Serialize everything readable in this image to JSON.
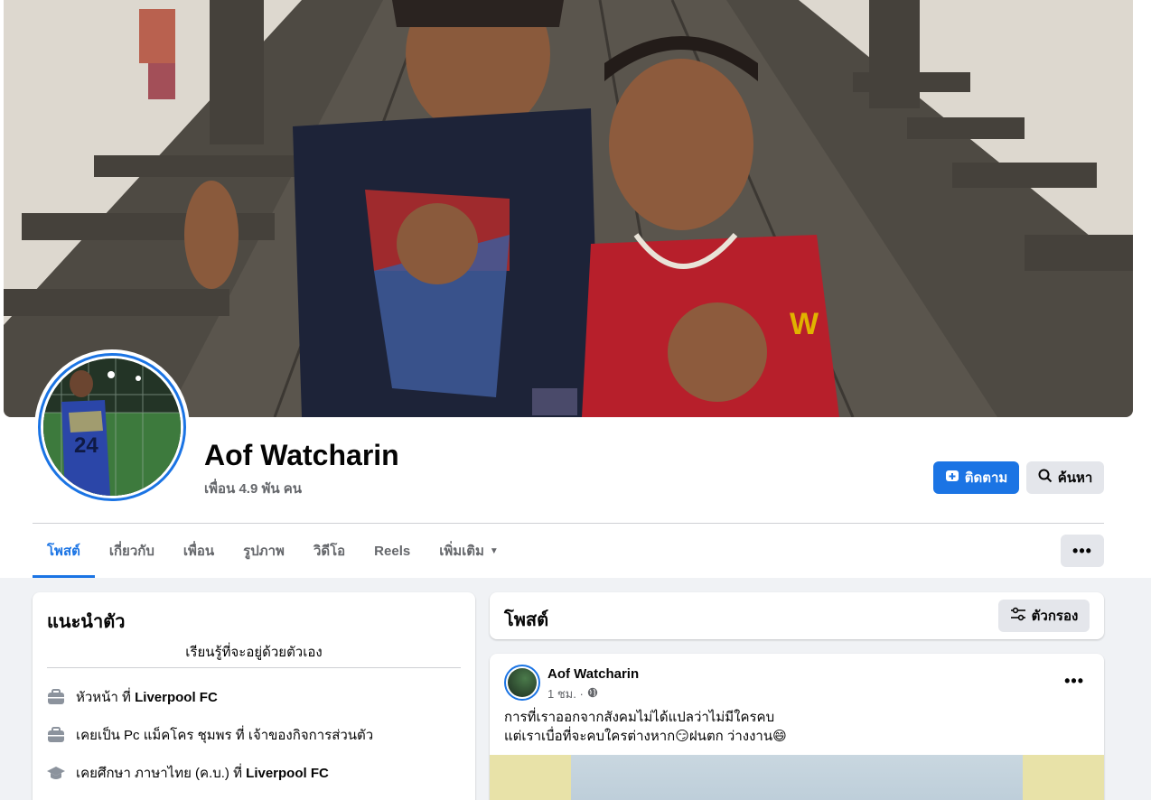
{
  "profile": {
    "name": "Aof Watcharin",
    "friends": "เพื่อน 4.9 พัน คน",
    "follow_label": "ติดตาม",
    "search_label": "ค้นหา"
  },
  "tabs": [
    {
      "label": "โพสต์",
      "active": true
    },
    {
      "label": "เกี่ยวกับ"
    },
    {
      "label": "เพื่อน"
    },
    {
      "label": "รูปภาพ"
    },
    {
      "label": "วิดีโอ"
    },
    {
      "label": "Reels"
    },
    {
      "label": "เพิ่มเติม"
    }
  ],
  "intro": {
    "title": "แนะนำตัว",
    "bio": "เรียนรู้ที่จะอยู่ด้วยตัวเอง",
    "items": [
      {
        "icon": "briefcase-icon",
        "prefix": "หัวหน้า ที่ ",
        "bold": "Liverpool FC"
      },
      {
        "icon": "briefcase-icon",
        "prefix": "เคยเป็น Pc แม็คโคร ชุมพร ที่ เจ้าของกิจการส่วนตัว",
        "bold": ""
      },
      {
        "icon": "graduation-cap-icon",
        "prefix": "เคยศึกษา ภาษาไทย (ค.บ.) ที่ ",
        "bold": "Liverpool FC"
      }
    ]
  },
  "posts_header": {
    "title": "โพสต์",
    "filter_label": "ตัวกรอง"
  },
  "post": {
    "author": "Aof Watcharin",
    "time": "1 ชม. ·",
    "line1": "การที่เราออกจากสังคมไม่ได้แปลว่าไม่มีใครคบ",
    "line2": "แต่เราเบื่อที่จะคบใครต่างหาก😏ฝนตก ว่างงาน😄"
  },
  "colors": {
    "accent": "#1b74e4",
    "secondary_button": "#e4e6eb",
    "page_background": "#f0f2f5"
  }
}
